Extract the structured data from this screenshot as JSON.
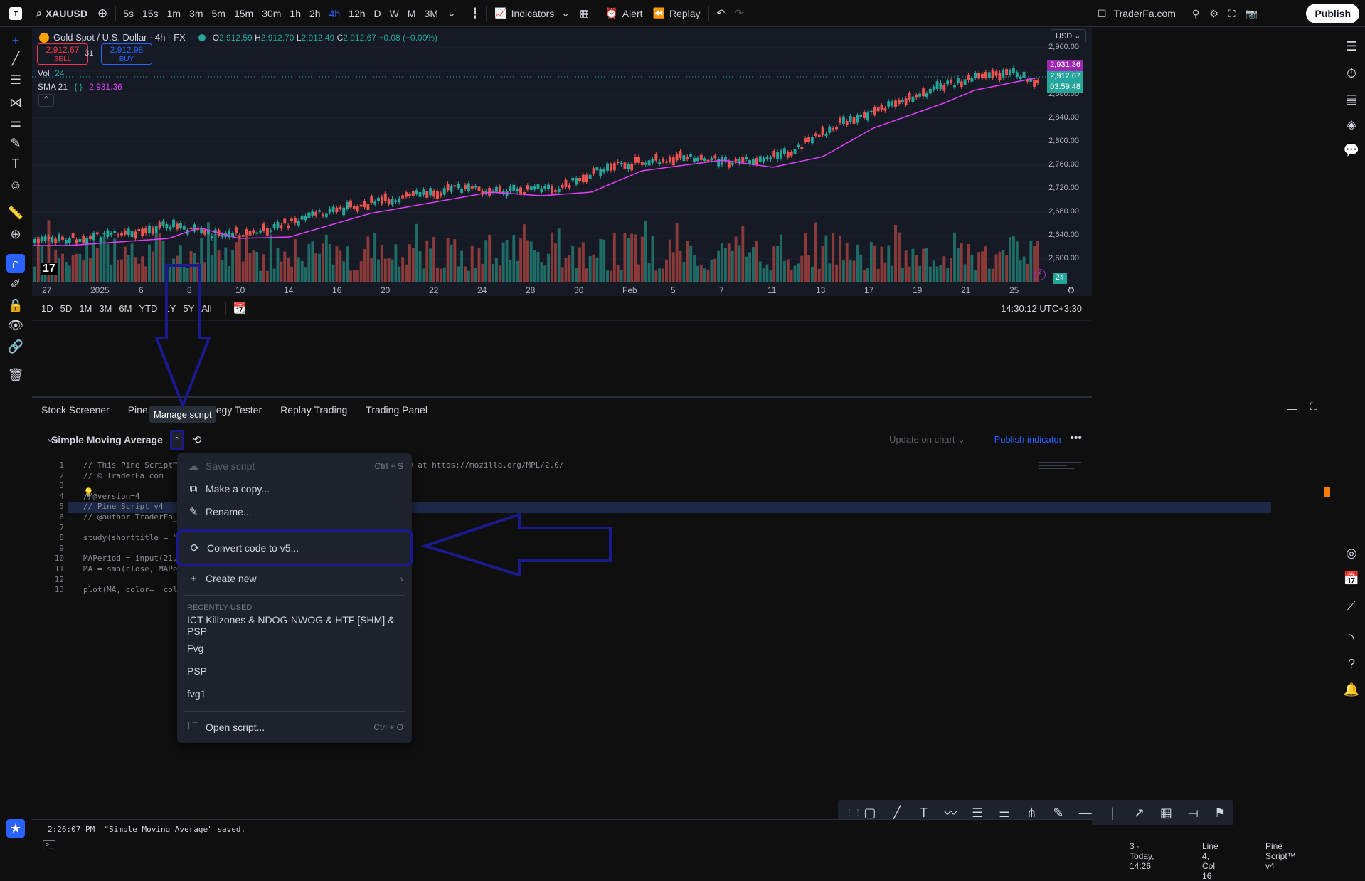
{
  "topbar": {
    "symbol": "XAUUSD",
    "intervals": [
      "5s",
      "15s",
      "1m",
      "3m",
      "5m",
      "15m",
      "30m",
      "1h",
      "2h",
      "4h",
      "12h",
      "D",
      "W",
      "M",
      "3M"
    ],
    "active_interval": "4h",
    "indicators_label": "Indicators",
    "alert_label": "Alert",
    "replay_label": "Replay",
    "layout_name": "TraderFa.com",
    "publish_label": "Publish"
  },
  "chart": {
    "title": "Gold Spot / U.S. Dollar · 4h · FX",
    "ohlc": {
      "o_label": "O",
      "o": "2,912.59",
      "h_label": "H",
      "h": "2,912.70",
      "l_label": "L",
      "l": "2,912.49",
      "c_label": "C",
      "c": "2,912.67",
      "change": "+0.08 (+0.00%)"
    },
    "sell_price": "2,912.67",
    "sell_label": "SELL",
    "spread": "31",
    "buy_price": "2,912.98",
    "buy_label": "BUY",
    "vol_label": "Vol",
    "vol_value": "24",
    "sma_label": "SMA 21",
    "sma_value": "2,931.36",
    "currency": "USD",
    "price_tag_sma": "2,931.36",
    "price_tag_last": "2,912.67",
    "price_tag_timer": "03:59:48",
    "vol_tag": "24",
    "y_ticks": [
      "2,960.00",
      "2,920.00",
      "2,880.00",
      "2,840.00",
      "2,800.00",
      "2,760.00",
      "2,720.00",
      "2,680.00",
      "2,640.00",
      "2,600.00"
    ],
    "x_ticks": [
      "27",
      "2025",
      "6",
      "8",
      "10",
      "14",
      "16",
      "20",
      "22",
      "24",
      "28",
      "30",
      "Feb",
      "5",
      "7",
      "11",
      "13",
      "17",
      "19",
      "21",
      "25"
    ],
    "colors": {
      "up": "#26a69a",
      "down": "#ef5350",
      "sma": "#e040fb",
      "bg": "#161a25"
    }
  },
  "rangebar": {
    "ranges": [
      "1D",
      "5D",
      "1M",
      "3M",
      "6M",
      "YTD",
      "1Y",
      "5Y",
      "All"
    ],
    "clock": "14:30:12 UTC+3:30"
  },
  "panel": {
    "tabs": [
      "Stock Screener",
      "Pine Editor",
      "Strategy Tester",
      "Replay Trading",
      "Trading Panel"
    ],
    "tooltip": "Manage script",
    "script_name": "Simple Moving Average",
    "update_label": "Update on chart",
    "publish_indicator": "Publish indicator"
  },
  "editor": {
    "lines": [
      {
        "n": "1",
        "text": "// This Pine Script™                                       License 2.0 at https://mozilla.org/MPL/2.0/"
      },
      {
        "n": "2",
        "text": "// © TraderFa_com"
      },
      {
        "n": "3",
        "text": ""
      },
      {
        "n": "4",
        "text": "//@version=4"
      },
      {
        "n": "5",
        "text": "// Pine Script v4"
      },
      {
        "n": "6",
        "text": "// @author TraderFa_"
      },
      {
        "n": "7",
        "text": ""
      },
      {
        "n": "8",
        "text": "study(shorttitle = \""
      },
      {
        "n": "9",
        "text": ""
      },
      {
        "n": "10",
        "text": "MAPeriod = input(21,"
      },
      {
        "n": "11",
        "text": "MA = sma(close, MAPer"
      },
      {
        "n": "12",
        "text": ""
      },
      {
        "n": "13",
        "text": "plot(MA, color=  col"
      }
    ]
  },
  "menu": {
    "save": {
      "label": "Save script",
      "key": "Ctrl + S"
    },
    "copy": "Make a copy...",
    "rename": "Rename...",
    "convert": "Convert code to v5...",
    "create": "Create new",
    "recent_header": "RECENTLY USED",
    "recent": [
      "ICT Killzones & NDOG-NWOG & HTF [SHM] & PSP",
      "Fvg",
      "PSP",
      "fvg1"
    ],
    "open": {
      "label": "Open script...",
      "key": "Ctrl + O"
    }
  },
  "status": {
    "message": "2:26:07 PM  \"Simple Moving Average\" saved.",
    "version_info": "3 · Today, 14:26",
    "position": "Line 4, Col 16",
    "language": "Pine Script™ v4"
  }
}
